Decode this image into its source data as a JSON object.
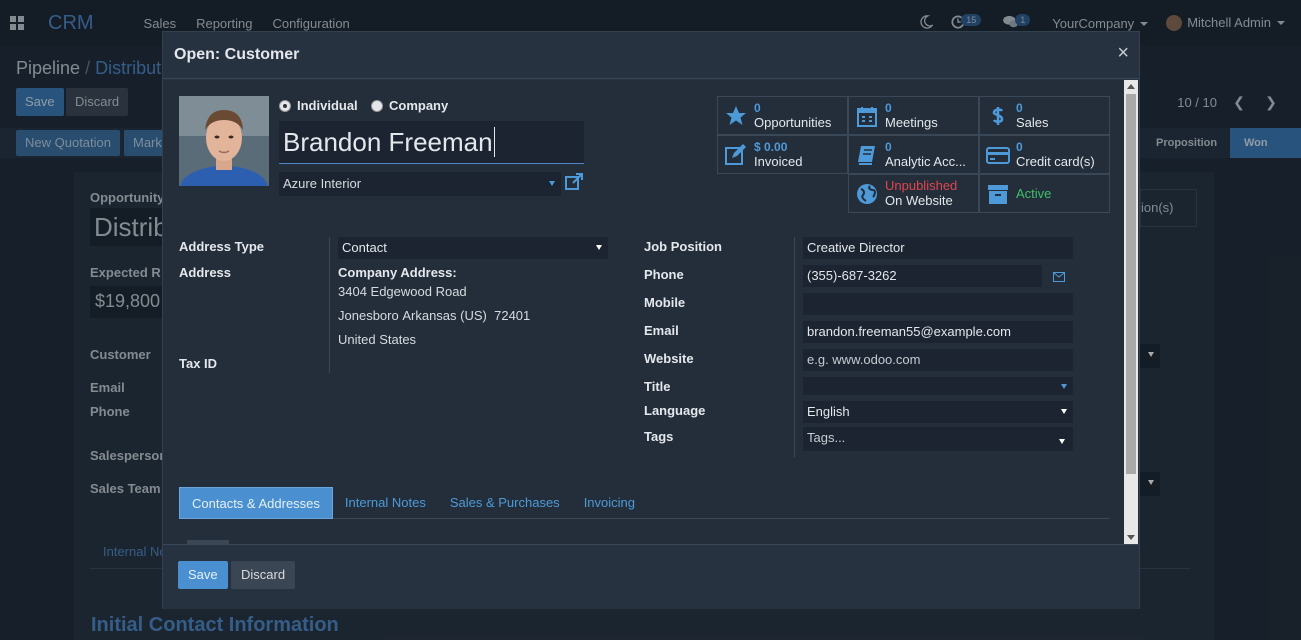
{
  "nav": {
    "brand": "CRM",
    "menu": [
      "Sales",
      "Reporting",
      "Configuration"
    ],
    "activity_count": "15",
    "message_count": "1",
    "company": "YourCompany",
    "user": "Mitchell Admin"
  },
  "background": {
    "breadcrumb_root": "Pipeline",
    "breadcrumb_sep": "/",
    "breadcrumb_current": "Distribut",
    "save_label": "Save",
    "discard_label": "Discard",
    "pager": "10 / 10",
    "new_quotation_label": "New Quotation",
    "mark_label": "Mark",
    "stage_proposition": "Proposition",
    "stage_won": "Won",
    "opportunity_label": "Opportunity",
    "opportunity_value": "Distrib",
    "expected_label": "Expected R",
    "expected_value": "$19,800",
    "customer_label": "Customer",
    "email_label": "Email",
    "phone_label": "Phone",
    "salesperson_label": "Salesperson",
    "salesteam_label": "Sales Team",
    "internal_notes_tab": "Internal No",
    "quotation_text": "ion(s)",
    "section_title": "Initial Contact Information"
  },
  "modal": {
    "title": "Open: Customer",
    "close": "×",
    "type_individual": "Individual",
    "type_company": "Company",
    "name": "Brandon Freeman",
    "company": "Azure Interior",
    "stats": [
      {
        "num": "0",
        "label": "Opportunities"
      },
      {
        "num": "0",
        "label": "Meetings"
      },
      {
        "num": "0",
        "label": "Sales"
      },
      {
        "num": "$ 0.00",
        "label": "Invoiced"
      },
      {
        "num": "0",
        "label": "Analytic Acc..."
      },
      {
        "num": "0",
        "label": "Credit card(s)"
      },
      {
        "num": "Unpublished",
        "label": "On Website"
      },
      {
        "num": "Active",
        "label": ""
      }
    ],
    "left": {
      "address_type_label": "Address Type",
      "address_type_value": "Contact",
      "address_label": "Address",
      "company_address_label": "Company Address:",
      "street": "3404 Edgewood Road",
      "city": "Jonesboro",
      "state": "Arkansas (US)",
      "zip": "72401",
      "country": "United States",
      "tax_label": "Tax ID"
    },
    "right": {
      "job_label": "Job Position",
      "job_value": "Creative Director",
      "phone_label": "Phone",
      "phone_value": "(355)-687-3262",
      "mobile_label": "Mobile",
      "mobile_value": "",
      "email_label": "Email",
      "email_value": "brandon.freeman55@example.com",
      "website_label": "Website",
      "website_placeholder": "e.g. www.odoo.com",
      "title_label": "Title",
      "title_value": "",
      "language_label": "Language",
      "language_value": "English",
      "tags_label": "Tags",
      "tags_placeholder": "Tags..."
    },
    "tabs": [
      "Contacts & Addresses",
      "Internal Notes",
      "Sales & Purchases",
      "Invoicing"
    ],
    "save_label": "Save",
    "discard_label": "Discard"
  },
  "colors": {
    "accent": "#4a90d0",
    "link": "#4e9ad8",
    "danger": "#e0454f",
    "success": "#3fbf6a"
  }
}
